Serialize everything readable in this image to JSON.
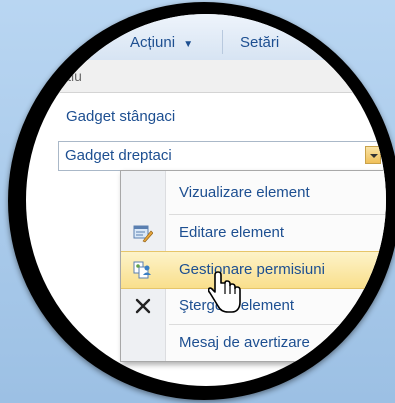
{
  "toolbar": {
    "actions_label": "Acțiuni",
    "settings_label": "Setări"
  },
  "list": {
    "column_header": "Titlu",
    "rows": [
      "Gadget stângaci"
    ],
    "selected_value": "Gadget dreptaci"
  },
  "context_menu": {
    "items": [
      {
        "label": "Vizualizare element",
        "icon": "none"
      },
      {
        "label": "Editare element",
        "icon": "edit-item-icon"
      },
      {
        "label": "Gestionare permisiuni",
        "icon": "permissions-icon"
      },
      {
        "label": "Ştergere element",
        "icon": "delete-icon"
      },
      {
        "label": "Mesaj de avertizare",
        "icon": "none"
      }
    ]
  },
  "colors": {
    "link_blue": "#1d4f91",
    "highlight": "#f9df8c",
    "frame": "#000000"
  }
}
